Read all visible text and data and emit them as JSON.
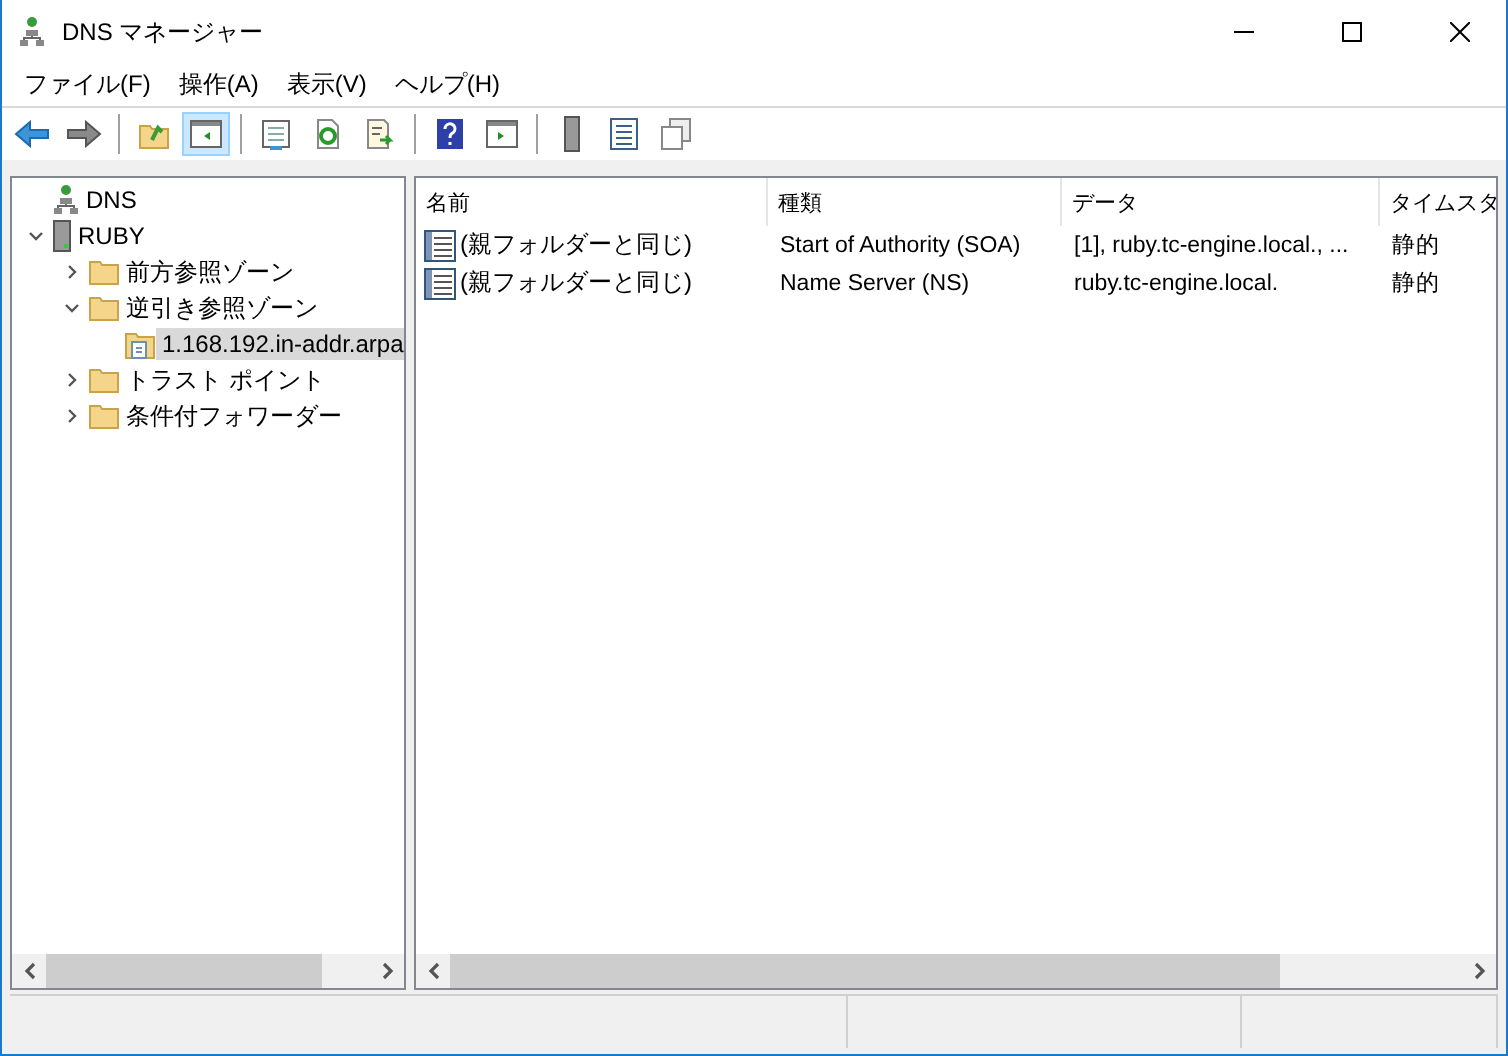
{
  "window": {
    "title": "DNS マネージャー"
  },
  "menu": [
    "ファイル(F)",
    "操作(A)",
    "表示(V)",
    "ヘルプ(H)"
  ],
  "toolbar": [
    {
      "kind": "back",
      "selected": false
    },
    {
      "kind": "forward",
      "selected": false
    },
    {
      "kind": "sep"
    },
    {
      "kind": "up",
      "selected": false
    },
    {
      "kind": "tree",
      "selected": true
    },
    {
      "kind": "sep"
    },
    {
      "kind": "properties",
      "selected": false
    },
    {
      "kind": "refresh",
      "selected": false
    },
    {
      "kind": "export",
      "selected": false
    },
    {
      "kind": "sep"
    },
    {
      "kind": "help",
      "selected": false
    },
    {
      "kind": "pane",
      "selected": false
    },
    {
      "kind": "sep"
    },
    {
      "kind": "server",
      "selected": false
    },
    {
      "kind": "records",
      "selected": false
    },
    {
      "kind": "copy",
      "selected": false
    }
  ],
  "tree": [
    {
      "label": "DNS",
      "kind": "dns",
      "selected": false,
      "children": [
        {
          "label": "RUBY",
          "kind": "server",
          "expanded": true,
          "selected": false,
          "children": [
            {
              "label": "前方参照ゾーン",
              "kind": "folder",
              "expanded": false,
              "selected": false
            },
            {
              "label": "逆引き参照ゾーン",
              "kind": "folder",
              "expanded": true,
              "selected": false,
              "children": [
                {
                  "label": "1.168.192.in-addr.arpa",
                  "kind": "zone",
                  "selected": true
                }
              ]
            },
            {
              "label": "トラスト ポイント",
              "kind": "folder",
              "expanded": false,
              "selected": false
            },
            {
              "label": "条件付フォワーダー",
              "kind": "folder",
              "expanded": false,
              "selected": false
            }
          ]
        }
      ]
    }
  ],
  "table": {
    "columns": [
      "名前",
      "種類",
      "データ",
      "タイムスタ"
    ],
    "rows": [
      [
        "(親フォルダーと同じ)",
        "Start of Authority (SOA)",
        "[1], ruby.tc-engine.local., ...",
        "静的"
      ],
      [
        "(親フォルダーと同じ)",
        "Name Server (NS)",
        "ruby.tc-engine.local.",
        "静的"
      ]
    ]
  }
}
